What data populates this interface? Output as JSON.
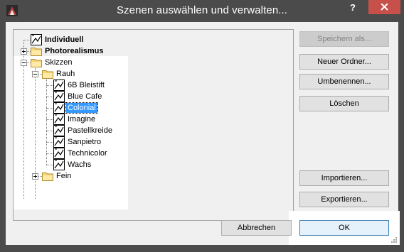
{
  "window": {
    "title": "Szenen auswählen und verwalten...",
    "help_label": "?",
    "close_label": "close"
  },
  "tree": {
    "nodes": [
      {
        "label": "Individuell",
        "icon": "scene-icon",
        "bold": true
      },
      {
        "label": "Photorealismus",
        "icon": "folder-icon",
        "bold": true,
        "expander": "+"
      },
      {
        "label": "Skizzen",
        "icon": "folder-icon",
        "bold": false,
        "expander": "-"
      },
      {
        "label": "Rauh",
        "icon": "folder-icon",
        "bold": false,
        "expander": "-"
      },
      {
        "label": "6B Bleistift",
        "icon": "scene-icon"
      },
      {
        "label": "Blue Cafe",
        "icon": "scene-icon"
      },
      {
        "label": "Colonial",
        "icon": "scene-icon",
        "selected": true
      },
      {
        "label": "Imagine",
        "icon": "scene-icon"
      },
      {
        "label": "Pastellkreide",
        "icon": "scene-icon"
      },
      {
        "label": "Sanpietro",
        "icon": "scene-icon"
      },
      {
        "label": "Technicolor",
        "icon": "scene-icon"
      },
      {
        "label": "Wachs",
        "icon": "scene-icon"
      },
      {
        "label": "Fein",
        "icon": "folder-icon",
        "expander": "+"
      }
    ]
  },
  "buttons": {
    "save_as": "Speichern als...",
    "new_folder": "Neuer Ordner...",
    "rename": "Umbenennen...",
    "delete": "Löschen",
    "import": "Importieren...",
    "export": "Exportieren...",
    "cancel": "Abbrechen",
    "ok": "OK"
  },
  "colors": {
    "titlebar": "#4b4b4b",
    "close": "#c7504b",
    "selection": "#3399ff"
  }
}
